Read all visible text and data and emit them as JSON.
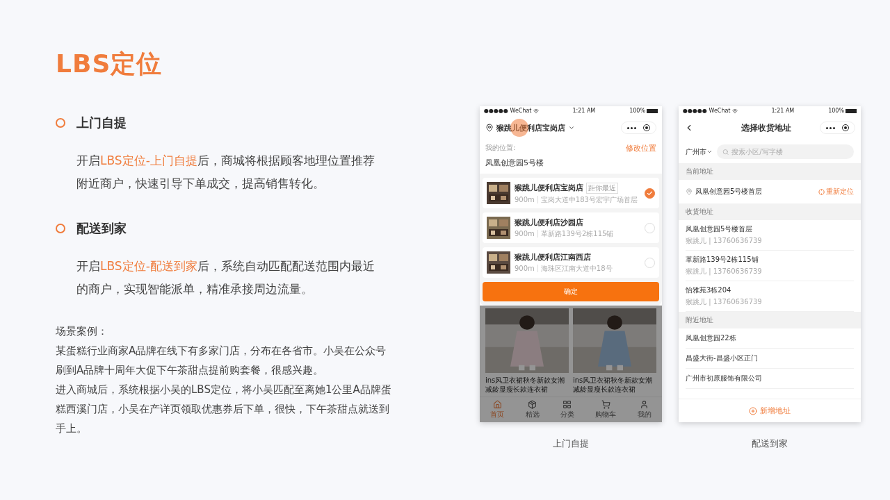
{
  "title": "LBS定位",
  "features": [
    {
      "heading": "上门自提",
      "description": [
        {
          "text": "开启",
          "highlight": false
        },
        {
          "text": "LBS定位-上门自提",
          "highlight": true
        },
        {
          "text": "后，商城将根据顾客地理位置推荐附近商户，快速引导下单成交，提高销售转化。",
          "highlight": false
        }
      ]
    },
    {
      "heading": "配送到家",
      "description": [
        {
          "text": "开启",
          "highlight": false
        },
        {
          "text": "LBS定位-配送到家",
          "highlight": true
        },
        {
          "text": "后，系统自动匹配配送范围内最近的商户，实现智能派单，精准承接周边流量。",
          "highlight": false
        }
      ]
    }
  ],
  "case": {
    "heading": "场景案例：",
    "paragraphs": [
      "某蛋糕行业商家A品牌在线下有多家门店，分布在各省市。小吴在公众号刷到A品牌十周年大促下午茶甜点提前购套餐，很感兴趣。",
      "进入商城后，系统根据小吴的LBS定位，将小吴匹配至离她1公里A品牌蛋糕西溪门店，小吴在产详页领取优惠券后下单，很快，下午茶甜点就送到手上。"
    ]
  },
  "pickup_phone": {
    "status": {
      "carrier": "●●●●● WeChat",
      "time": "1:21 AM",
      "battery": "100%"
    },
    "store_name": "猴跳儿便利店宝岗店",
    "location_label": "我的位置:",
    "location": "凤凰创意园5号楼",
    "change_location": "修改位置",
    "stores": [
      {
        "name": "猴跳儿便利店宝岗店",
        "tag": "距你最近",
        "distance": "900m",
        "address": "宝岗大道中183号宏宇广场首层",
        "selected": true
      },
      {
        "name": "猴跳儿便利店沙园店",
        "distance": "900m",
        "address": "革新路139号2栋115铺",
        "selected": false
      },
      {
        "name": "猴跳儿便利店江南西店",
        "distance": "900m",
        "address": "海珠区江南大道中18号",
        "selected": false
      }
    ],
    "confirm": "确定",
    "products": [
      {
        "title": "ins风卫衣裙秋冬新款女潮减龄显瘦长款连衣裙"
      },
      {
        "title": "ins风卫衣裙秋冬新款女潮减龄显瘦长款连衣裙"
      }
    ],
    "tabs": [
      {
        "label": "首页",
        "selected": true
      },
      {
        "label": "精选",
        "selected": false
      },
      {
        "label": "分类",
        "selected": false
      },
      {
        "label": "购物车",
        "selected": false
      },
      {
        "label": "我的",
        "selected": false
      }
    ],
    "caption": "上门自提"
  },
  "delivery_phone": {
    "status": {
      "carrier": "●●●●● WeChat",
      "time": "1:21 AM",
      "battery": "100%"
    },
    "title": "选择收货地址",
    "city": "广州市",
    "search_placeholder": "搜索小区/写字楼",
    "sections": [
      {
        "heading": "当前地址",
        "kind": "current",
        "items": [
          {
            "address": "凤凰创意园5号楼首层",
            "action": "重新定位"
          }
        ]
      },
      {
        "heading": "收货地址",
        "kind": "saved",
        "items": [
          {
            "address": "凤凰创意园5号楼首层",
            "contact": "猴跳儿 | 13760636739"
          },
          {
            "address": "革新路139号2栋115铺",
            "contact": "猴跳儿 | 13760636739"
          },
          {
            "address": "怡雅苑3栋204",
            "contact": "猴跳儿 | 13760636739"
          }
        ]
      },
      {
        "heading": "附近地址",
        "kind": "nearby",
        "items": [
          {
            "address": "凤凰创意园22栋"
          },
          {
            "address": "昌盛大街-昌盛小区正门"
          },
          {
            "address": "广州市初原服饰有限公司"
          }
        ]
      }
    ],
    "add_button": "新增地址",
    "caption": "配送到家"
  }
}
